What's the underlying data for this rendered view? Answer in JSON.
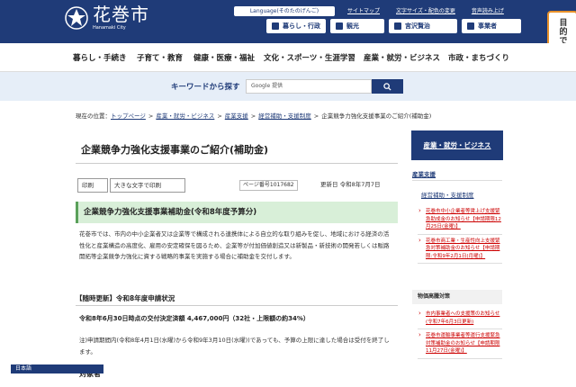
{
  "header": {
    "logo_ja": "花巻市",
    "logo_en": "Hanamaki City",
    "language_button": "Language(そのたのげんご)",
    "util_links": [
      "サイトマップ",
      "文字サイズ・配色の変更",
      "音声読み上げ"
    ],
    "category_buttons": [
      "暮らし・行政",
      "観光",
      "宮沢賢治",
      "事業者"
    ],
    "lookup_label": "目的で探す",
    "lookup_chevron": "︾"
  },
  "global_nav": [
    "暮らし・手続き",
    "子育て・教育",
    "健康・医療・福祉",
    "文化・スポーツ・生涯学習",
    "産業・就労・ビジネス",
    "市政・まちづくり"
  ],
  "search": {
    "label": "キーワードから探す",
    "placeholder": "Google 提供"
  },
  "breadcrumb": {
    "prefix": "現在の位置：",
    "links": [
      "トップページ",
      "産業・就労・ビジネス",
      "産業支援",
      "経営補助・支援制度"
    ],
    "current": "企業競争力強化支援事業のご紹介(補助金)"
  },
  "main": {
    "title": "企業競争力強化支援事業のご紹介(補助金)",
    "print_label": "印刷",
    "large_print_label": "大きな文字で印刷",
    "page_number": "ページ番号1017682",
    "updated": "更新日 令和8年7月7日",
    "section_heading": "企業競争力強化支援事業補助金(令和8年度予算分)",
    "body": "花巻市では、市内の中小企業者又は企業等で構成される連携体による自立的な取り組みを促し、地域における経済の活性化と産業構造の高度化、雇用の安定確保を図るため、企業等が付加価値創造又は新製品・新技術の開発若しくは販路開拓等企業競争力強化に資する戦略的事業を実施する場合に補助金を交付します。",
    "subheading": "【随時更新】令和8年度申請状況",
    "status_line": "令和8年6月30日時点の交付決定済額 4,467,000円（32社・上限額の約34%）",
    "note": "注)申請期間内(令和8年4月1日(水曜)から令和9年3月10日(水曜))であっても、予算の上限に達した場合は受付を終了します。",
    "next_heading": "対象者"
  },
  "language_bar": "日本語",
  "sidebar": {
    "head": "産業・就労・ビジネス",
    "cat1": "産業支援",
    "link1": "経営補助・支援制度",
    "news1": [
      "花巻市中小企業者等賃上げ支援緊急助成金のお知らせ【申請期限12月25日(金曜)】",
      "花巻市商工業・生産性向上支援緊急対策補助金のお知らせ【申請期限:令和9年2月1日(月曜)】"
    ],
    "section_label": "物価高騰対策",
    "news2": [
      "市内事業者への支援策のお知らせ(令和7年6月3日更新)",
      "花巻市運輸事業者等運行支援緊急対策補助金のお知らせ【申請期限11月27日(金曜)】"
    ]
  },
  "colors": {
    "brand": "#1f3b78",
    "accent": "#e8912a",
    "heading_bg": "#d8efd8",
    "news_link": "#cc0000"
  }
}
